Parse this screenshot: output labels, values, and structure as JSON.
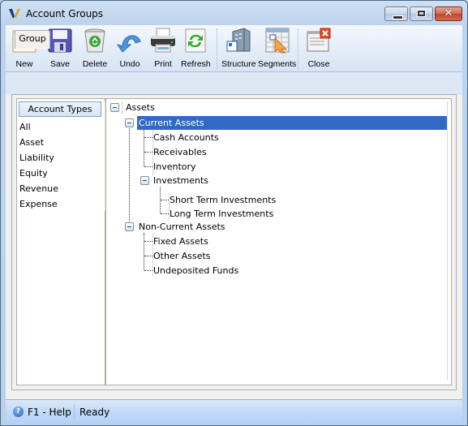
{
  "window": {
    "title": "Account Groups",
    "logo_icon": "v-logo-icon",
    "controls": {
      "minimize_icon": "minimize-icon",
      "maximize_icon": "maximize-icon",
      "close_glyph": "✕"
    }
  },
  "toolbar": {
    "buttons": [
      {
        "id": "new",
        "label": "New",
        "icon": "new-document-icon"
      },
      {
        "id": "save",
        "label": "Save",
        "icon": "floppy-disk-icon"
      },
      {
        "id": "delete",
        "label": "Delete",
        "icon": "recycle-bin-icon"
      },
      {
        "id": "undo",
        "label": "Undo",
        "icon": "undo-arrow-icon"
      },
      {
        "id": "print",
        "label": "Print",
        "icon": "printer-icon"
      },
      {
        "id": "refresh",
        "label": "Refresh",
        "icon": "refresh-icon"
      },
      {
        "id": "structure",
        "label": "Structure",
        "icon": "building-icon"
      },
      {
        "id": "segments",
        "label": "Segments",
        "icon": "segments-grid-icon"
      },
      {
        "id": "close",
        "label": "Close",
        "icon": "close-window-icon"
      }
    ]
  },
  "tabs": [
    {
      "label": "Group",
      "active": true
    }
  ],
  "account_types": {
    "header": "Account Types",
    "items": [
      "All",
      "Asset",
      "Liability",
      "Equity",
      "Revenue",
      "Expense"
    ]
  },
  "tree": {
    "selected": "Current Assets",
    "nodes": [
      {
        "label": "Assets",
        "level": 0,
        "expanded": true
      },
      {
        "label": "Current Assets",
        "level": 1,
        "expanded": true,
        "selected": true
      },
      {
        "label": "Cash Accounts",
        "level": 2
      },
      {
        "label": "Receivables",
        "level": 2
      },
      {
        "label": "Inventory",
        "level": 2
      },
      {
        "label": "Investments",
        "level": 2,
        "expanded": true
      },
      {
        "label": "Short Term Investments",
        "level": 3
      },
      {
        "label": "Long Term Investments",
        "level": 3
      },
      {
        "label": "Non-Current Assets",
        "level": 1,
        "expanded": true
      },
      {
        "label": "Fixed Assets",
        "level": 2
      },
      {
        "label": "Other Assets",
        "level": 2
      },
      {
        "label": "Undeposited Funds",
        "level": 2
      }
    ]
  },
  "statusbar": {
    "help_glyph": "?",
    "help_text": "F1 - Help",
    "status_text": "Ready"
  },
  "colors": {
    "selection": "#316ac5",
    "titlebar": "#bdd3ec",
    "close_button": "#c1452a"
  }
}
